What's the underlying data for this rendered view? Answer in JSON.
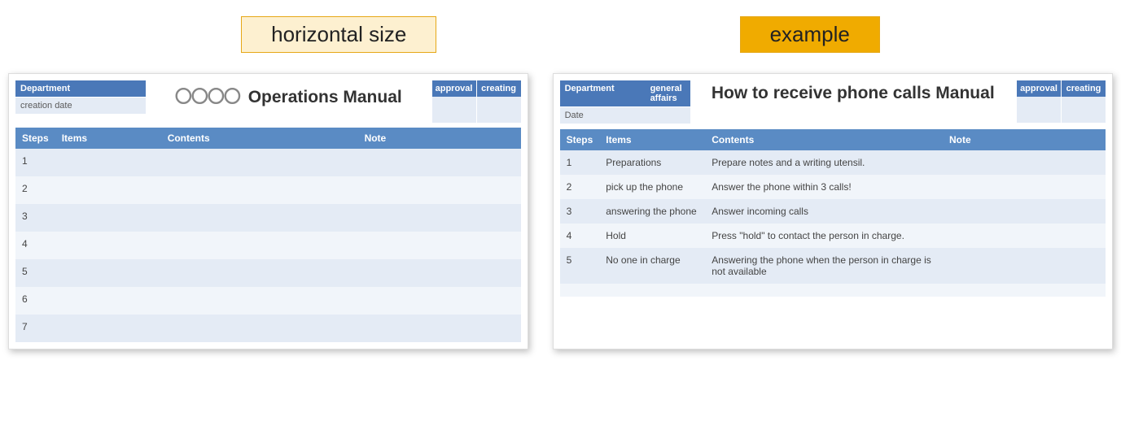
{
  "labels": {
    "left": "horizontal size",
    "right": "example"
  },
  "template": {
    "meta": {
      "department_label": "Department",
      "department_value": "",
      "date_label": "creation date",
      "date_value": ""
    },
    "title_prefix": "〇〇〇〇",
    "title": "Operations Manual",
    "approval": {
      "col1": "approval",
      "col2": "creating"
    },
    "columns": {
      "steps": "Steps",
      "items": "Items",
      "contents": "Contents",
      "note": "Note"
    },
    "rows": [
      {
        "step": "1",
        "items": "",
        "contents": "",
        "note": ""
      },
      {
        "step": "2",
        "items": "",
        "contents": "",
        "note": ""
      },
      {
        "step": "3",
        "items": "",
        "contents": "",
        "note": ""
      },
      {
        "step": "4",
        "items": "",
        "contents": "",
        "note": ""
      },
      {
        "step": "5",
        "items": "",
        "contents": "",
        "note": ""
      },
      {
        "step": "6",
        "items": "",
        "contents": "",
        "note": ""
      },
      {
        "step": "7",
        "items": "",
        "contents": "",
        "note": ""
      }
    ]
  },
  "example": {
    "meta": {
      "department_label": "Department",
      "department_value": "general affairs",
      "date_label": "Date",
      "date_value": ""
    },
    "title": "How to receive phone calls Manual",
    "approval": {
      "col1": "approval",
      "col2": "creating"
    },
    "columns": {
      "steps": "Steps",
      "items": "Items",
      "contents": "Contents",
      "note": "Note"
    },
    "rows": [
      {
        "step": "1",
        "items": "Preparations",
        "contents": "Prepare notes and a writing utensil.",
        "note": ""
      },
      {
        "step": "2",
        "items": "pick up the phone",
        "contents": "Answer the phone within 3 calls!",
        "note": ""
      },
      {
        "step": "3",
        "items": "answering the phone",
        "contents": "Answer incoming calls",
        "note": ""
      },
      {
        "step": "4",
        "items": "Hold",
        "contents": "Press \"hold\" to contact the person in charge.",
        "note": ""
      },
      {
        "step": "5",
        "items": "No one in charge",
        "contents": "Answering the phone when the person in charge is not available",
        "note": ""
      },
      {
        "step": "",
        "items": "",
        "contents": "",
        "note": ""
      }
    ]
  }
}
